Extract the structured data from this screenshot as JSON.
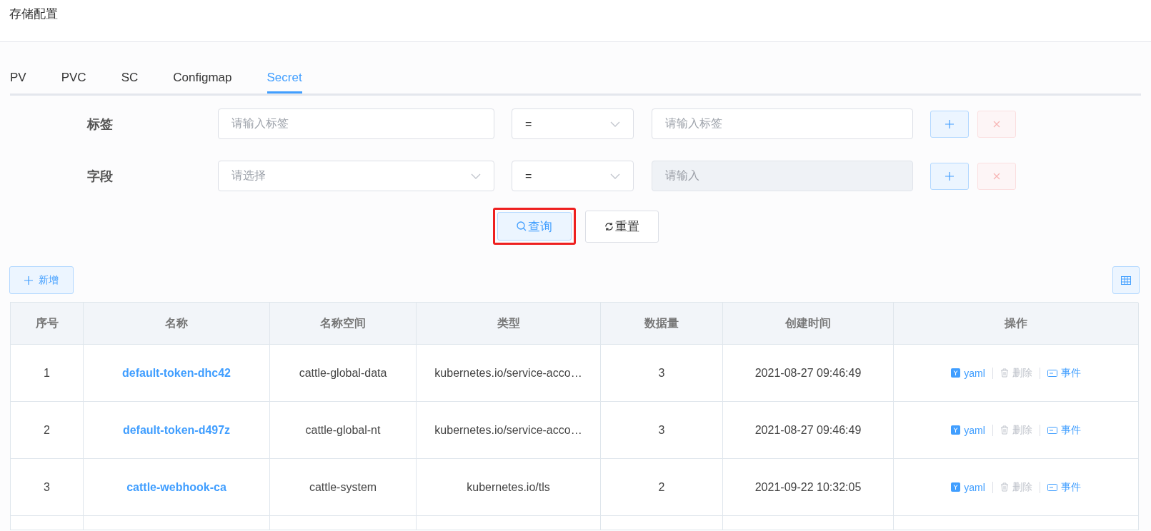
{
  "page_title": "存储配置",
  "tabs": [
    {
      "label": "PV",
      "selected": false
    },
    {
      "label": "PVC",
      "selected": false
    },
    {
      "label": "SC",
      "selected": false
    },
    {
      "label": "Configmap",
      "selected": false
    },
    {
      "label": "Secret",
      "selected": true
    }
  ],
  "filters": [
    {
      "label": "标签",
      "key": {
        "kind": "input",
        "placeholder": "请输入标签"
      },
      "operator": "=",
      "value": {
        "placeholder": "请输入标签",
        "disabled": false
      },
      "add_disabled": false,
      "remove_disabled": true
    },
    {
      "label": "字段",
      "key": {
        "kind": "select",
        "placeholder": "请选择"
      },
      "operator": "=",
      "value": {
        "placeholder": "请输入",
        "disabled": true
      },
      "add_disabled": false,
      "remove_disabled": true
    }
  ],
  "query_button": {
    "label": "查询",
    "highlighted": true
  },
  "reset_button": {
    "label": "重置"
  },
  "add_button": {
    "label": "新增"
  },
  "table": {
    "columns": [
      "序号",
      "名称",
      "名称空间",
      "类型",
      "数据量",
      "创建时间",
      "操作"
    ],
    "rows": [
      {
        "index": "1",
        "name": "default-token-dhc42",
        "namespace": "cattle-global-data",
        "type": "kubernetes.io/service-acco…",
        "count": "3",
        "created": "2021-08-27 09:46:49",
        "actions": [
          {
            "kind": "yaml",
            "label": "yaml",
            "disabled": false
          },
          {
            "kind": "delete",
            "label": "删除",
            "disabled": true
          },
          {
            "kind": "events",
            "label": "事件",
            "disabled": false
          }
        ]
      },
      {
        "index": "2",
        "name": "default-token-d497z",
        "namespace": "cattle-global-nt",
        "type": "kubernetes.io/service-acco…",
        "count": "3",
        "created": "2021-08-27 09:46:49",
        "actions": [
          {
            "kind": "yaml",
            "label": "yaml",
            "disabled": false
          },
          {
            "kind": "delete",
            "label": "删除",
            "disabled": true
          },
          {
            "kind": "events",
            "label": "事件",
            "disabled": false
          }
        ]
      },
      {
        "index": "3",
        "name": "cattle-webhook-ca",
        "namespace": "cattle-system",
        "type": "kubernetes.io/tls",
        "count": "2",
        "created": "2021-09-22 10:32:05",
        "actions": [
          {
            "kind": "yaml",
            "label": "yaml",
            "disabled": false
          },
          {
            "kind": "delete",
            "label": "删除",
            "disabled": true
          },
          {
            "kind": "events",
            "label": "事件",
            "disabled": false
          }
        ]
      }
    ]
  }
}
